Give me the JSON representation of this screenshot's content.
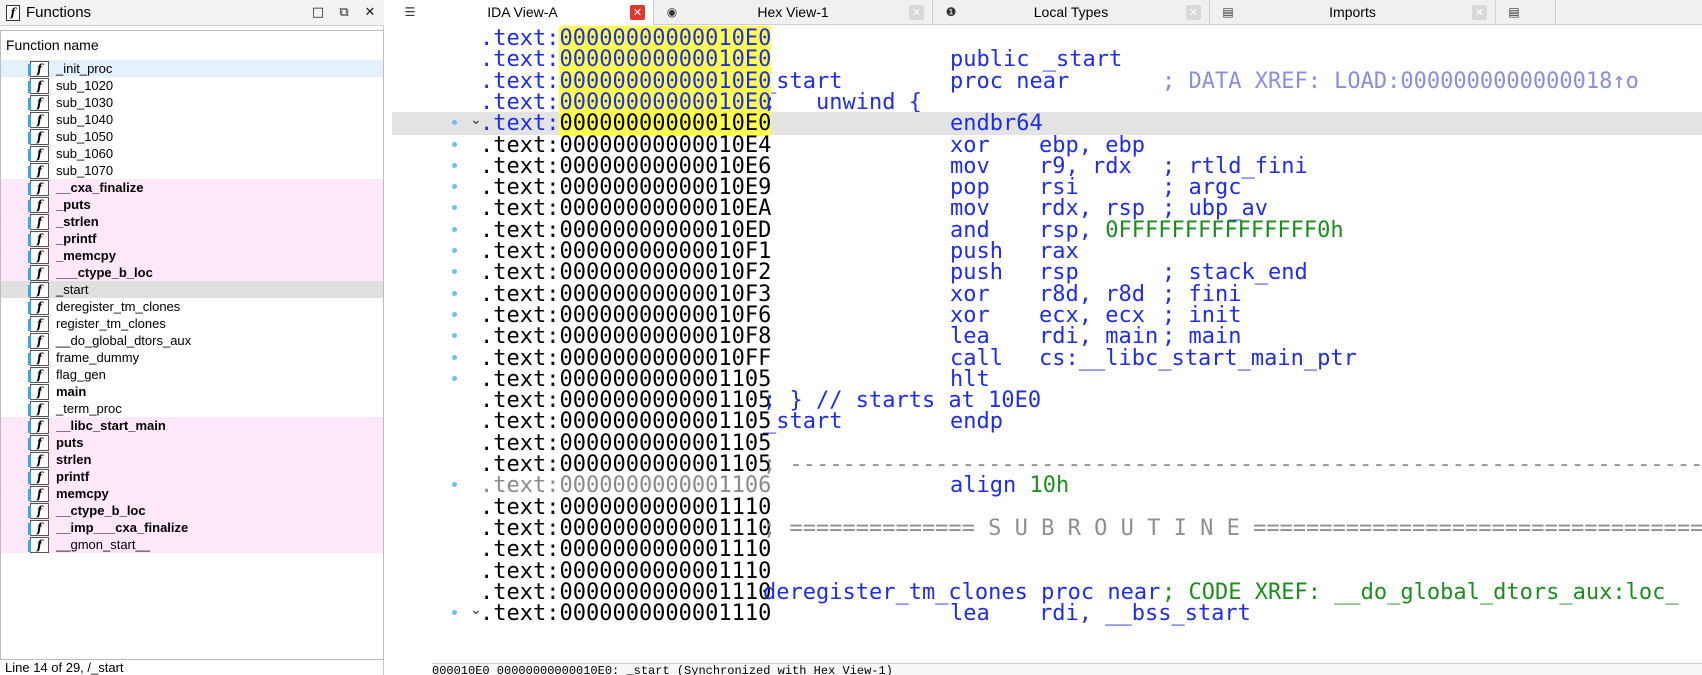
{
  "functions_panel": {
    "title": "Functions",
    "header": "Function name",
    "status": "Line 14 of 29, /_start",
    "window_buttons": [
      "□",
      "⧉",
      "✕"
    ],
    "items": [
      {
        "name": "_init_proc",
        "kind": "highlight",
        "bold": false
      },
      {
        "name": "sub_1020",
        "kind": "normal",
        "bold": false
      },
      {
        "name": "sub_1030",
        "kind": "normal",
        "bold": false
      },
      {
        "name": "sub_1040",
        "kind": "normal",
        "bold": false
      },
      {
        "name": "sub_1050",
        "kind": "normal",
        "bold": false
      },
      {
        "name": "sub_1060",
        "kind": "normal",
        "bold": false
      },
      {
        "name": "sub_1070",
        "kind": "normal",
        "bold": false
      },
      {
        "name": "__cxa_finalize",
        "kind": "lib",
        "bold": true
      },
      {
        "name": "_puts",
        "kind": "lib",
        "bold": true
      },
      {
        "name": "_strlen",
        "kind": "lib",
        "bold": true
      },
      {
        "name": "_printf",
        "kind": "lib",
        "bold": true
      },
      {
        "name": "_memcpy",
        "kind": "lib",
        "bold": true
      },
      {
        "name": "___ctype_b_loc",
        "kind": "lib",
        "bold": true
      },
      {
        "name": "_start",
        "kind": "selected",
        "bold": false
      },
      {
        "name": "deregister_tm_clones",
        "kind": "normal",
        "bold": false
      },
      {
        "name": "register_tm_clones",
        "kind": "normal",
        "bold": false
      },
      {
        "name": "__do_global_dtors_aux",
        "kind": "normal",
        "bold": false
      },
      {
        "name": "frame_dummy",
        "kind": "normal",
        "bold": false
      },
      {
        "name": "flag_gen",
        "kind": "normal",
        "bold": false
      },
      {
        "name": "main",
        "kind": "normal",
        "bold": true
      },
      {
        "name": "_term_proc",
        "kind": "normal",
        "bold": false
      },
      {
        "name": "__libc_start_main",
        "kind": "lib",
        "bold": true
      },
      {
        "name": "puts",
        "kind": "lib",
        "bold": true
      },
      {
        "name": "strlen",
        "kind": "lib",
        "bold": true
      },
      {
        "name": "printf",
        "kind": "lib",
        "bold": true
      },
      {
        "name": "memcpy",
        "kind": "lib",
        "bold": true
      },
      {
        "name": "__ctype_b_loc",
        "kind": "lib",
        "bold": true
      },
      {
        "name": "__imp___cxa_finalize",
        "kind": "lib",
        "bold": true
      },
      {
        "name": "__gmon_start__",
        "kind": "lib",
        "bold": false
      }
    ]
  },
  "tabs": [
    {
      "label": "IDA View-A",
      "icon": "listing-icon",
      "active": true
    },
    {
      "label": "Hex View-1",
      "icon": "hex-icon",
      "active": false
    },
    {
      "label": "Local Types",
      "icon": "types-icon",
      "active": false
    },
    {
      "label": "Imports",
      "icon": "imports-icon",
      "active": false
    }
  ],
  "code_status": "000010E0 00000000000010E0: _start (Synchronized with Hex View-1)",
  "code_lines": [
    {
      "addr": ".text:00000000000010E0",
      "addr_style": "blue-hl",
      "dot": false,
      "caret": "",
      "cursor": false,
      "label": "",
      "mnem": "",
      "ops": "",
      "cmt": ""
    },
    {
      "addr": ".text:00000000000010E0",
      "addr_style": "blue-hl",
      "dot": false,
      "caret": "",
      "cursor": false,
      "label": "",
      "mnem": "public _start",
      "ops": "",
      "cmt": ""
    },
    {
      "addr": ".text:00000000000010E0",
      "addr_style": "blue-hl",
      "dot": false,
      "caret": "",
      "cursor": false,
      "label": "_start",
      "mnem": "proc near",
      "ops": "",
      "cmt": "; DATA XREF: LOAD:0000000000000018↑o",
      "cmt_style": "xref"
    },
    {
      "addr": ".text:00000000000010E0",
      "addr_style": "blue-hl",
      "dot": false,
      "caret": "",
      "cursor": false,
      "label": "; __unwind {",
      "mnem": "",
      "ops": "",
      "cmt": ""
    },
    {
      "addr": ".text:00000000000010E0",
      "addr_style": "blue-hl",
      "dot": true,
      "caret": "⌄",
      "cursor": true,
      "label": "",
      "mnem": "endbr64",
      "ops": "",
      "cmt": ""
    },
    {
      "addr": ".text:00000000000010E4",
      "addr_style": "black",
      "dot": true,
      "caret": "",
      "cursor": false,
      "label": "",
      "mnem": "xor",
      "ops": "ebp, ebp",
      "cmt": ""
    },
    {
      "addr": ".text:00000000000010E6",
      "addr_style": "black",
      "dot": true,
      "caret": "",
      "cursor": false,
      "label": "",
      "mnem": "mov",
      "ops": "r9, rdx",
      "cmt": "; rtld_fini"
    },
    {
      "addr": ".text:00000000000010E9",
      "addr_style": "black",
      "dot": true,
      "caret": "",
      "cursor": false,
      "label": "",
      "mnem": "pop",
      "ops": "rsi",
      "cmt": "; argc"
    },
    {
      "addr": ".text:00000000000010EA",
      "addr_style": "black",
      "dot": true,
      "caret": "",
      "cursor": false,
      "label": "",
      "mnem": "mov",
      "ops": "rdx, rsp",
      "cmt": "; ubp_av"
    },
    {
      "addr": ".text:00000000000010ED",
      "addr_style": "black",
      "dot": true,
      "caret": "",
      "cursor": false,
      "label": "",
      "mnem": "and",
      "ops": "rsp, ",
      "ops_green": "0FFFFFFFFFFFFFFF0h",
      "cmt": ""
    },
    {
      "addr": ".text:00000000000010F1",
      "addr_style": "black",
      "dot": true,
      "caret": "",
      "cursor": false,
      "label": "",
      "mnem": "push",
      "ops": "rax",
      "cmt": ""
    },
    {
      "addr": ".text:00000000000010F2",
      "addr_style": "black",
      "dot": true,
      "caret": "",
      "cursor": false,
      "label": "",
      "mnem": "push",
      "ops": "rsp",
      "cmt": "; stack_end"
    },
    {
      "addr": ".text:00000000000010F3",
      "addr_style": "black",
      "dot": true,
      "caret": "",
      "cursor": false,
      "label": "",
      "mnem": "xor",
      "ops": "r8d, r8d",
      "cmt": "; fini"
    },
    {
      "addr": ".text:00000000000010F6",
      "addr_style": "black",
      "dot": true,
      "caret": "",
      "cursor": false,
      "label": "",
      "mnem": "xor",
      "ops": "ecx, ecx",
      "cmt": "; init"
    },
    {
      "addr": ".text:00000000000010F8",
      "addr_style": "black",
      "dot": true,
      "caret": "",
      "cursor": false,
      "label": "",
      "mnem": "lea",
      "ops": "rdi, main",
      "cmt": "; main"
    },
    {
      "addr": ".text:00000000000010FF",
      "addr_style": "black",
      "dot": true,
      "caret": "",
      "cursor": false,
      "label": "",
      "mnem": "call",
      "ops": "cs:__libc_start_main_ptr",
      "cmt": ""
    },
    {
      "addr": ".text:0000000000001105",
      "addr_style": "black",
      "dot": true,
      "caret": "",
      "cursor": false,
      "label": "",
      "mnem": "hlt",
      "ops": "",
      "cmt": ""
    },
    {
      "addr": ".text:0000000000001105",
      "addr_style": "black",
      "dot": false,
      "caret": "",
      "cursor": false,
      "label": "; } // starts at 10E0",
      "mnem": "",
      "ops": "",
      "cmt": ""
    },
    {
      "addr": ".text:0000000000001105",
      "addr_style": "black",
      "dot": false,
      "caret": "",
      "cursor": false,
      "label": "_start",
      "mnem": "endp",
      "ops": "",
      "cmt": ""
    },
    {
      "addr": ".text:0000000000001105",
      "addr_style": "black",
      "dot": false,
      "caret": "",
      "cursor": false,
      "label": "",
      "mnem": "",
      "ops": "",
      "cmt": ""
    },
    {
      "addr": ".text:0000000000001105",
      "addr_style": "black",
      "dot": false,
      "caret": "",
      "cursor": false,
      "label": "; -----------------------------------------------------------------------",
      "label_style": "gray",
      "mnem": "",
      "ops": "",
      "cmt": ""
    },
    {
      "addr": ".text:0000000000001106",
      "addr_style": "gray",
      "dot": true,
      "caret": "",
      "cursor": false,
      "label": "",
      "mnem": "align ",
      "mnem_green": "10h",
      "ops": "",
      "cmt": ""
    },
    {
      "addr": ".text:0000000000001110",
      "addr_style": "black",
      "dot": false,
      "caret": "",
      "cursor": false,
      "label": "",
      "mnem": "",
      "ops": "",
      "cmt": ""
    },
    {
      "addr": ".text:0000000000001110",
      "addr_style": "black",
      "dot": false,
      "caret": "",
      "cursor": false,
      "label": "; ============== S U B R O U T I N E =====================================",
      "label_style": "gray",
      "mnem": "",
      "ops": "",
      "cmt": ""
    },
    {
      "addr": ".text:0000000000001110",
      "addr_style": "black",
      "dot": false,
      "caret": "",
      "cursor": false,
      "label": "",
      "mnem": "",
      "ops": "",
      "cmt": ""
    },
    {
      "addr": ".text:0000000000001110",
      "addr_style": "black",
      "dot": false,
      "caret": "",
      "cursor": false,
      "label": "",
      "mnem": "",
      "ops": "",
      "cmt": ""
    },
    {
      "addr": ".text:0000000000001110",
      "addr_style": "black",
      "dot": false,
      "caret": "",
      "cursor": false,
      "label": "deregister_tm_clones proc near",
      "mnem": "",
      "ops": "",
      "cmt": "; CODE XREF: __do_global_dtors_aux:loc_",
      "cmt_style": "green"
    },
    {
      "addr": ".text:0000000000001110",
      "addr_style": "black",
      "dot": true,
      "caret": "⌄",
      "cursor": false,
      "label": "",
      "mnem": "lea",
      "ops": "rdi, __bss_start",
      "cmt": ""
    }
  ]
}
